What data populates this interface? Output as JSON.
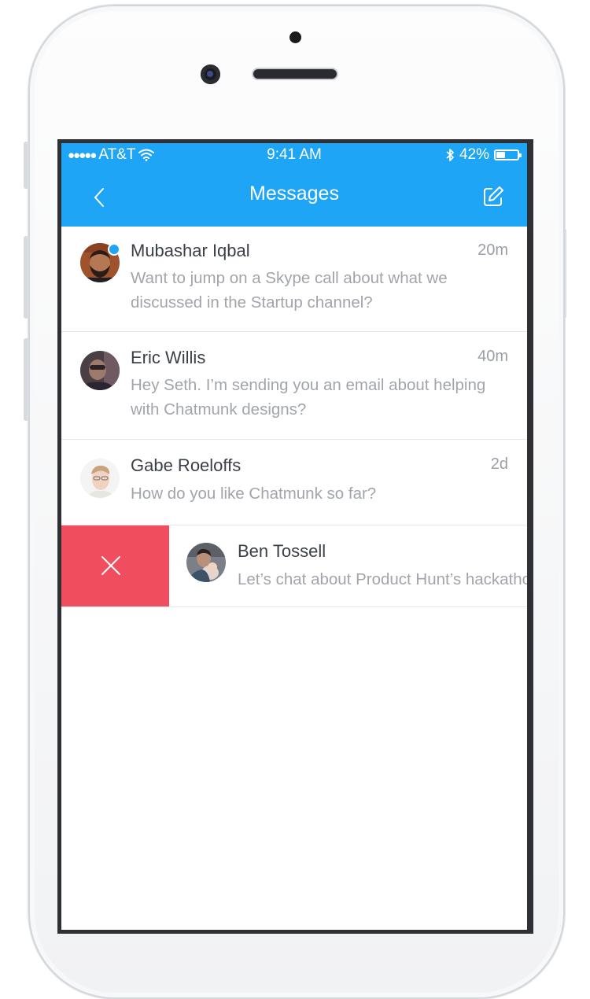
{
  "status_bar": {
    "signal": "●●●●●",
    "carrier": "AT&T",
    "time": "9:41 AM",
    "battery_text": "42%",
    "battery_level": 0.42
  },
  "nav": {
    "title": "Messages",
    "back_icon": "chevron-left-icon",
    "compose_icon": "compose-icon"
  },
  "messages": [
    {
      "name": "Mubashar Iqbal",
      "time": "20m",
      "preview_line1": "Want to jump on a Skype call about what we",
      "preview_line2": "discussed in the Startup channel?",
      "online": true
    },
    {
      "name": "Eric Willis",
      "time": "40m",
      "preview_line1": "Hey Seth. I’m sending you an email about helping",
      "preview_line2": "with Chatmunk designs?"
    },
    {
      "name": "Gabe Roeloffs",
      "time": "2d",
      "preview_line1": "How do you like Chatmunk so far?"
    },
    {
      "name": "Ben Tossell",
      "preview_line1": "Let’s chat about Product Hunt’s hackathon"
    }
  ],
  "colors": {
    "accent": "#1ea5f5",
    "delete": "#f04e5f",
    "name_text": "#3b4047",
    "secondary_text": "#a1a5ab"
  }
}
